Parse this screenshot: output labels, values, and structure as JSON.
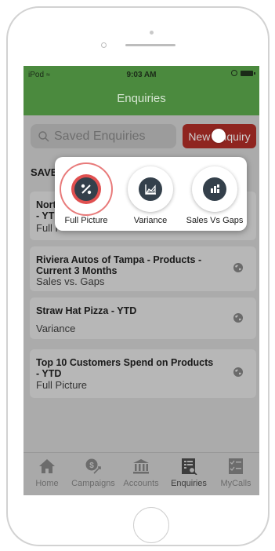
{
  "status": {
    "carrier": "iPod",
    "time": "9:03 AM"
  },
  "header": {
    "title": "Enquiries"
  },
  "search": {
    "placeholder": "Saved Enquiries"
  },
  "new_button": {
    "label": "New Enquiry"
  },
  "section": {
    "label": "SAVE"
  },
  "enquiries": [
    {
      "title": "Nort\n- YT",
      "subtitle": "Full P"
    },
    {
      "title": "Riviera Autos of Tampa - Products - Current 3 Months",
      "subtitle": "Sales vs. Gaps"
    },
    {
      "title": "Straw Hat Pizza - YTD",
      "subtitle": "Variance"
    },
    {
      "title": "Top 10 Customers Spend on Products - YTD",
      "subtitle": "Full Picture"
    }
  ],
  "popup": {
    "options": [
      {
        "label": "Full Picture",
        "icon": "percent-icon",
        "selected": true
      },
      {
        "label": "Variance",
        "icon": "area-chart-icon",
        "selected": false
      },
      {
        "label": "Sales Vs Gaps",
        "icon": "bar-gap-icon",
        "selected": false
      }
    ]
  },
  "tabs": [
    {
      "label": "Home",
      "icon": "home-icon",
      "active": false
    },
    {
      "label": "Campaigns",
      "icon": "campaign-icon",
      "active": false
    },
    {
      "label": "Accounts",
      "icon": "bank-icon",
      "active": false
    },
    {
      "label": "Enquiries",
      "icon": "enquiries-icon",
      "active": true
    },
    {
      "label": "MyCalls",
      "icon": "checklist-icon",
      "active": false
    }
  ],
  "colors": {
    "appbar": "#4b8a3e",
    "new_button": "#8f2520",
    "popup_icon": "#34404b",
    "selected_ring": "#e05050"
  }
}
